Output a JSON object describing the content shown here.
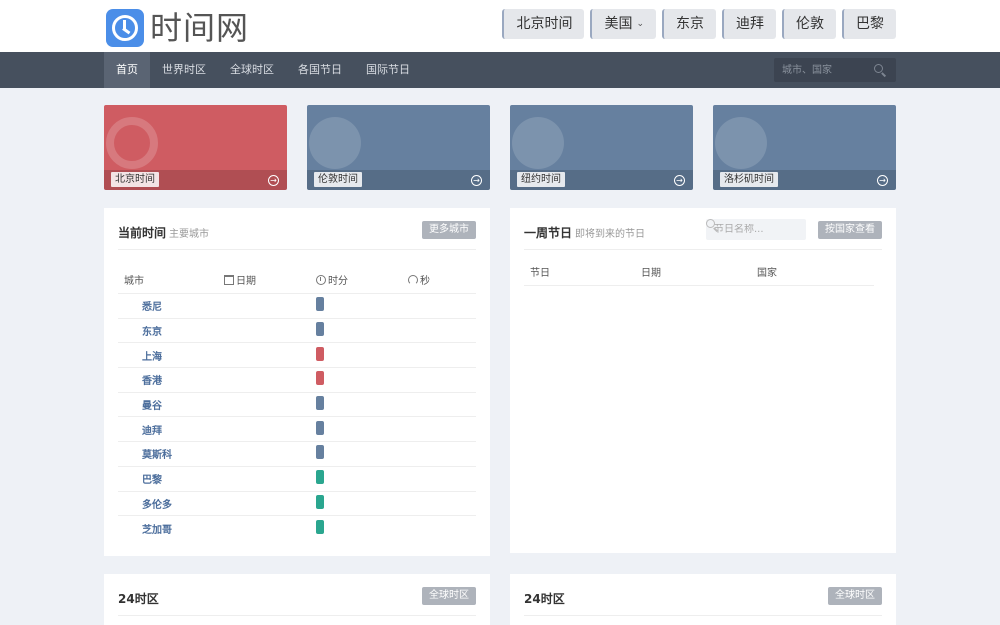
{
  "logo": {
    "text": "时间网"
  },
  "quick_links": [
    {
      "label": "北京时间"
    },
    {
      "label": "美国",
      "dropdown": true
    },
    {
      "label": "东京"
    },
    {
      "label": "迪拜"
    },
    {
      "label": "伦敦"
    },
    {
      "label": "巴黎"
    }
  ],
  "nav": {
    "items": [
      "首页",
      "世界时区",
      "全球时区",
      "各国节日",
      "国际节日"
    ],
    "active_index": 0,
    "search_placeholder": "城市、国家"
  },
  "tiles": [
    {
      "label": "北京时间",
      "color": "#cf5c62",
      "icon": "clock-icon"
    },
    {
      "label": "伦敦时间",
      "color": "#66809f",
      "icon": "globe-icon"
    },
    {
      "label": "纽约时间",
      "color": "#66809f",
      "icon": "globe-icon"
    },
    {
      "label": "洛杉矶时间",
      "color": "#66809f",
      "icon": "globe-icon"
    }
  ],
  "current_time": {
    "title": "当前时间",
    "subtitle": "主要城市",
    "button": "更多城市",
    "columns": [
      "城市",
      "日期",
      "时分",
      "秒"
    ],
    "rows": [
      {
        "city": "悉尼",
        "color": "#66809f"
      },
      {
        "city": "东京",
        "color": "#66809f"
      },
      {
        "city": "上海",
        "color": "#cf5c62"
      },
      {
        "city": "香港",
        "color": "#cf5c62"
      },
      {
        "city": "曼谷",
        "color": "#66809f"
      },
      {
        "city": "迪拜",
        "color": "#66809f"
      },
      {
        "city": "莫斯科",
        "color": "#66809f"
      },
      {
        "city": "巴黎",
        "color": "#2aa68f"
      },
      {
        "city": "多伦多",
        "color": "#2aa68f"
      },
      {
        "city": "芝加哥",
        "color": "#2aa68f"
      }
    ]
  },
  "holidays": {
    "title": "一周节日",
    "subtitle": "即将到来的节日",
    "search_placeholder": "节日名称...",
    "button": "按国家查看",
    "columns": [
      "节日",
      "日期",
      "国家"
    ]
  },
  "tz_left": {
    "title": "24时区",
    "button": "全球时区"
  },
  "tz_right": {
    "title": "24时区",
    "button": "全球时区"
  }
}
